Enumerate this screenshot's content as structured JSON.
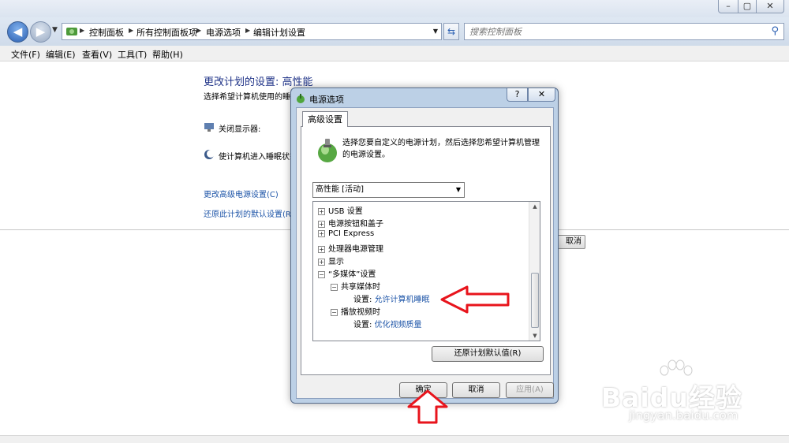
{
  "window": {
    "min_glyph": "–",
    "max_glyph": "▢",
    "close_glyph": "✕"
  },
  "address": {
    "crumbs": [
      "控制面板",
      "所有控制面板项",
      "电源选项",
      "编辑计划设置"
    ]
  },
  "search": {
    "placeholder": "搜索控制面板"
  },
  "menu": [
    "文件(F)",
    "编辑(E)",
    "查看(V)",
    "工具(T)",
    "帮助(H)"
  ],
  "content": {
    "title": "更改计划的设置: 高性能",
    "description": "选择希望计算机使用的睡眠",
    "settings": [
      "关闭显示器:",
      "使计算机进入睡眠状态"
    ],
    "links": [
      "更改高级电源设置(C)",
      "还原此计划的默认设置(R)"
    ],
    "cancel_label": "取消"
  },
  "dialog": {
    "title": "电源选项",
    "help_label": "?",
    "close_label": "✕",
    "tab": "高级设置",
    "description": "选择您要自定义的电源计划，然后选择您希望计算机管理的电源设置。",
    "plan_select_value": "高性能 [活动]",
    "tree": [
      {
        "label": "USB 设置",
        "expander": "+"
      },
      {
        "label": "电源按钮和盖子",
        "expander": "+"
      },
      {
        "label": "PCI Express",
        "expander": "+"
      },
      {
        "label": "处理器电源管理",
        "expander": "+"
      },
      {
        "label": "显示",
        "expander": "+"
      },
      {
        "label": "“多媒体”设置",
        "expander": "−"
      },
      {
        "label": "共享媒体时",
        "expander": "−"
      },
      {
        "setting_prefix": "设置:",
        "setting_value": "允许计算机睡眠"
      },
      {
        "label": "播放视频时",
        "expander": "−"
      },
      {
        "setting_prefix": "设置:",
        "setting_value": "优化视频质量"
      }
    ],
    "restore_button": "还原计划默认值(R)",
    "ok_button": "确定",
    "cancel_button": "取消",
    "apply_button": "应用(A)"
  },
  "watermark": {
    "logo_text": "Baidu经验",
    "url": "jingyan.baidu.com"
  },
  "colors": {
    "link_blue": "#1e55a8",
    "title_blue": "#1e3287",
    "annotation_red": "#e8141c"
  }
}
